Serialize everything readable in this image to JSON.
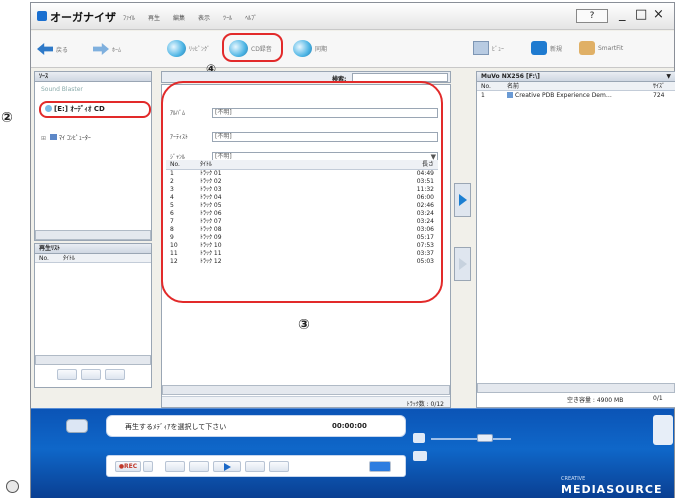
{
  "annotations": {
    "n2": "②",
    "n3": "③",
    "n4": "④"
  },
  "window": {
    "title": "オーガナイザ",
    "menu": [
      "ﾌｧｲﾙ",
      "再生",
      "編集",
      "表示",
      "ﾂｰﾙ",
      "ﾍﾙﾌﾟ"
    ],
    "help_label": "?",
    "controls": {
      "min": "_",
      "max": "□",
      "close": "×"
    }
  },
  "toolbar": {
    "back_label": "戻る",
    "fwd_label": "ﾎｰﾑ",
    "rip_label": "ﾘｯﾋﾟﾝｸﾞ",
    "cd_label": "CD録音",
    "sync_label": "同期",
    "view_label": "ﾋﾞｭｰ",
    "new_label": "新規",
    "smartfit_label": "SmartFit"
  },
  "tree": {
    "header": "ｿｰｽ",
    "items": [
      "Sound Blaster",
      "[E:] ｵｰﾃﾞｨｵ CD",
      "ﾏｲ ｺﾝﾋﾟｭｰﾀｰ"
    ]
  },
  "playlist": {
    "header": "再生ﾘｽﾄ",
    "cols": [
      "No.",
      "ﾀｲﾄﾙ"
    ]
  },
  "center": {
    "search_label": "検索:",
    "album_label": "ｱﾙﾊﾞﾑ",
    "album_value": "[不明]",
    "artist_label": "ｱｰﾃｨｽﾄ",
    "artist_value": "[不明]",
    "genre_label": "ｼﾞｬﾝﾙ",
    "genre_value": "[不明]",
    "cols": [
      "No.",
      "ﾀｲﾄﾙ",
      "長さ"
    ],
    "tracks": [
      {
        "no": "1",
        "title": "ﾄﾗｯｸ 01",
        "len": "04:49"
      },
      {
        "no": "2",
        "title": "ﾄﾗｯｸ 02",
        "len": "03:51"
      },
      {
        "no": "3",
        "title": "ﾄﾗｯｸ 03",
        "len": "11:32"
      },
      {
        "no": "4",
        "title": "ﾄﾗｯｸ 04",
        "len": "06:00"
      },
      {
        "no": "5",
        "title": "ﾄﾗｯｸ 05",
        "len": "02:46"
      },
      {
        "no": "6",
        "title": "ﾄﾗｯｸ 06",
        "len": "03:24"
      },
      {
        "no": "7",
        "title": "ﾄﾗｯｸ 07",
        "len": "03:24"
      },
      {
        "no": "8",
        "title": "ﾄﾗｯｸ 08",
        "len": "03:06"
      },
      {
        "no": "9",
        "title": "ﾄﾗｯｸ 09",
        "len": "05:17"
      },
      {
        "no": "10",
        "title": "ﾄﾗｯｸ 10",
        "len": "07:53"
      },
      {
        "no": "11",
        "title": "ﾄﾗｯｸ 11",
        "len": "03:37"
      },
      {
        "no": "12",
        "title": "ﾄﾗｯｸ 12",
        "len": "05:03"
      }
    ],
    "status": "ﾄﾗｯｸ数 : 0/12"
  },
  "right": {
    "device": "MuVo NX256 [F:\\]",
    "cols": [
      "No.",
      "名前",
      "ｻｲｽﾞ"
    ],
    "row": {
      "no": "1",
      "name": "Creative PDB Experience Dem…",
      "size": "724"
    },
    "status_free": "空き容量 : 4900 MB",
    "status_count": "0/1"
  },
  "player": {
    "message": "再生するﾒﾃﾞｨｱを選択して下さい",
    "time": "00:00:00",
    "rec_label": "●REC",
    "brand_small": "CREATIVE",
    "brand": "MEDIASOURCE"
  }
}
